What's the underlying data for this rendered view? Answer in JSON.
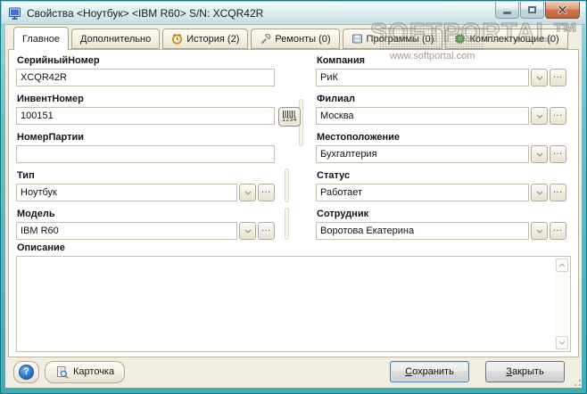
{
  "window": {
    "title": "Свойства <Ноутбук> <IBM R60> S/N: XCQR42R"
  },
  "watermark": {
    "brand": "SOFTPORTAL™",
    "url": "www.softportal.com"
  },
  "tabs": [
    {
      "label": "Главное",
      "active": true
    },
    {
      "label": "Дополнительно",
      "active": false
    },
    {
      "label": "История (2)",
      "active": false,
      "icon": "alarm-clock-icon"
    },
    {
      "label": "Ремонты (0)",
      "active": false,
      "icon": "wrench-icon"
    },
    {
      "label": "Программы (0)",
      "active": false,
      "icon": "floppy-disk-icon"
    },
    {
      "label": "Комплектующие (0)",
      "active": false,
      "icon": "chip-icon"
    }
  ],
  "form": {
    "left": [
      {
        "label": "СерийныйНомер",
        "value": "XCQR42R",
        "type": "text"
      },
      {
        "label": "ИнвентНомер",
        "value": "100151",
        "type": "text-with-barcode"
      },
      {
        "label": "НомерПартии",
        "value": "",
        "type": "text"
      },
      {
        "label": "Тип",
        "value": "Ноутбук",
        "type": "combo"
      },
      {
        "label": "Модель",
        "value": "IBM R60",
        "type": "combo"
      }
    ],
    "right": [
      {
        "label": "Компания",
        "value": "РиК",
        "type": "combo"
      },
      {
        "label": "Филиал",
        "value": "Москва",
        "type": "combo"
      },
      {
        "label": "Местоположение",
        "value": "Бухгалтерия",
        "type": "combo"
      },
      {
        "label": "Статус",
        "value": "Работает",
        "type": "combo"
      },
      {
        "label": "Сотрудник",
        "value": "Воротова Екатерина",
        "type": "combo"
      }
    ],
    "description": {
      "label": "Описание",
      "value": ""
    },
    "barcode_caption": "1234"
  },
  "footer": {
    "help_glyph": "?",
    "card_label": "Карточка",
    "save_key": "С",
    "save_rest": "охранить",
    "close_key": "З",
    "close_rest": "акрыть"
  }
}
